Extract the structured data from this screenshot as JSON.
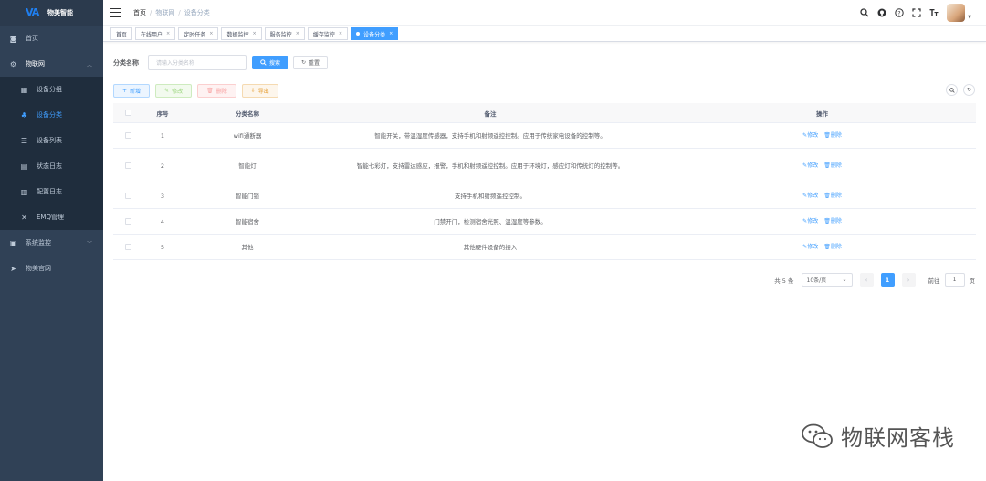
{
  "app": {
    "title": "物美智能",
    "logo": "wm-logo-mark"
  },
  "sidebar": {
    "items": [
      {
        "label": "首页",
        "icon": "dashboard-icon"
      },
      {
        "label": "物联网",
        "icon": "gear-icon",
        "expanded": true,
        "children": [
          {
            "label": "设备分组",
            "icon": "grid-icon"
          },
          {
            "label": "设备分类",
            "icon": "people-icon",
            "active": true
          },
          {
            "label": "设备列表",
            "icon": "list-icon"
          },
          {
            "label": "状态日志",
            "icon": "log-icon"
          },
          {
            "label": "配置日志",
            "icon": "doc-icon"
          },
          {
            "label": "EMQ管理",
            "icon": "close-x-icon"
          }
        ]
      },
      {
        "label": "系统监控",
        "icon": "monitor-icon"
      },
      {
        "label": "物美官网",
        "icon": "send-icon"
      }
    ]
  },
  "breadcrumb": [
    "首页",
    "物联网",
    "设备分类"
  ],
  "tags": [
    {
      "label": "首页",
      "active": false,
      "closable": false
    },
    {
      "label": "在线用户",
      "active": false,
      "closable": true
    },
    {
      "label": "定时任务",
      "active": false,
      "closable": true
    },
    {
      "label": "数据监控",
      "active": false,
      "closable": true
    },
    {
      "label": "服务监控",
      "active": false,
      "closable": true
    },
    {
      "label": "缓存监控",
      "active": false,
      "closable": true
    },
    {
      "label": "设备分类",
      "active": true,
      "closable": true
    }
  ],
  "search": {
    "label": "分类名称",
    "placeholder": "请输入分类名称",
    "search_label": "搜索",
    "reset_label": "重置"
  },
  "toolbar": {
    "add": "新增",
    "edit": "修改",
    "delete": "删除",
    "export": "导出"
  },
  "table": {
    "headers": {
      "no": "序号",
      "name": "分类名称",
      "note": "备注",
      "ops": "操作"
    },
    "rows": [
      {
        "no": "1",
        "name": "wifi通断器",
        "note": "智能开关，带温湿度传感器，支持手机和射频遥控控制。应用于传统家电设备的控制等。"
      },
      {
        "no": "2",
        "name": "智能灯",
        "note": "智能七彩灯，支持雷达感应，报警，手机和射频遥控控制。应用于环境灯，感应灯和传统灯的控制等。"
      },
      {
        "no": "3",
        "name": "智能门锁",
        "note": "支持手机和射频遥控控制。"
      },
      {
        "no": "4",
        "name": "智能宿舍",
        "note": "门禁开门，检测宿舍光照、温湿度等参数。"
      },
      {
        "no": "5",
        "name": "其他",
        "note": "其他硬件设备的接入"
      }
    ],
    "op_edit": "修改",
    "op_delete": "删除"
  },
  "pagination": {
    "total": "共 5 条",
    "page_size": "10条/页",
    "current": "1",
    "goto_prefix": "前往",
    "goto_value": "1",
    "goto_suffix": "页"
  },
  "watermark": "物联网客栈"
}
